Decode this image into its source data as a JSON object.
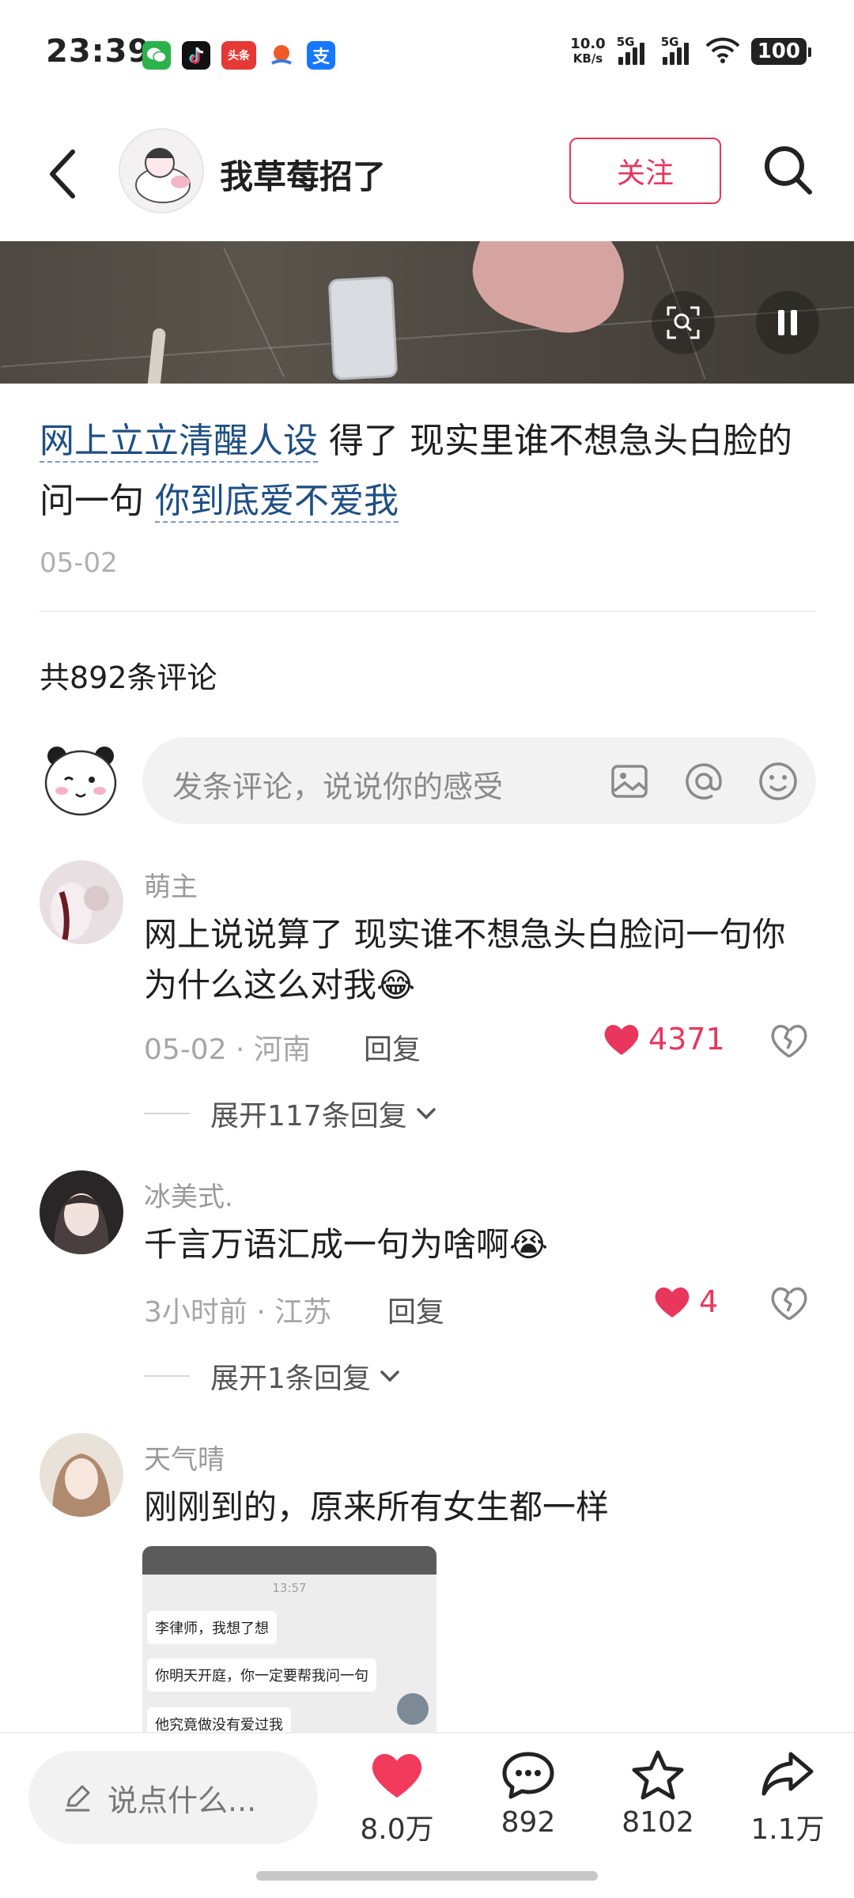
{
  "status_bar": {
    "time": "23:39",
    "net_speed_value": "10.0",
    "net_speed_unit": "KB/s",
    "signal_label_1": "5G",
    "signal_label_2": "5G",
    "battery": "100",
    "toutiao_label": "头条",
    "alipay_label": "支"
  },
  "header": {
    "author_name": "我草莓招了",
    "follow_label": "关注"
  },
  "post": {
    "caption_tag_1": "网上立立清醒人设",
    "caption_text": " 得了 现实里谁不想急头白脸的问一句 ",
    "caption_tag_2": "你到底爱不爱我",
    "date": "05-02"
  },
  "comments_section": {
    "count_label": "共892条评论",
    "input_placeholder": "发条评论，说说你的感受"
  },
  "comments": [
    {
      "user": "萌主",
      "text": "网上说说算了 现实谁不想急头白脸问一句你为什么这么对我😂",
      "meta": "05-02 · 河南",
      "reply_label": "回复",
      "likes": "4371",
      "expand_label": "展开117条回复"
    },
    {
      "user": "冰美式.",
      "text": "千言万语汇成一句为啥啊😭",
      "meta": "3小时前 · 江苏",
      "reply_label": "回复",
      "likes": "4",
      "expand_label": "展开1条回复"
    },
    {
      "user": "天气晴",
      "text": "刚刚到的，原来所有女生都一样",
      "image": {
        "time": "13:57",
        "bubbles": [
          "李律师，我想了想",
          "你明天开庭，你一定要帮我问一句",
          "他究竟做没有爱过我"
        ]
      }
    }
  ],
  "bottom_bar": {
    "say_placeholder": "说点什么...",
    "likes": "8.0万",
    "comments": "892",
    "favorites": "8102",
    "shares": "1.1万"
  },
  "colors": {
    "accent": "#e8365d",
    "tag_blue": "#1e4f86"
  }
}
